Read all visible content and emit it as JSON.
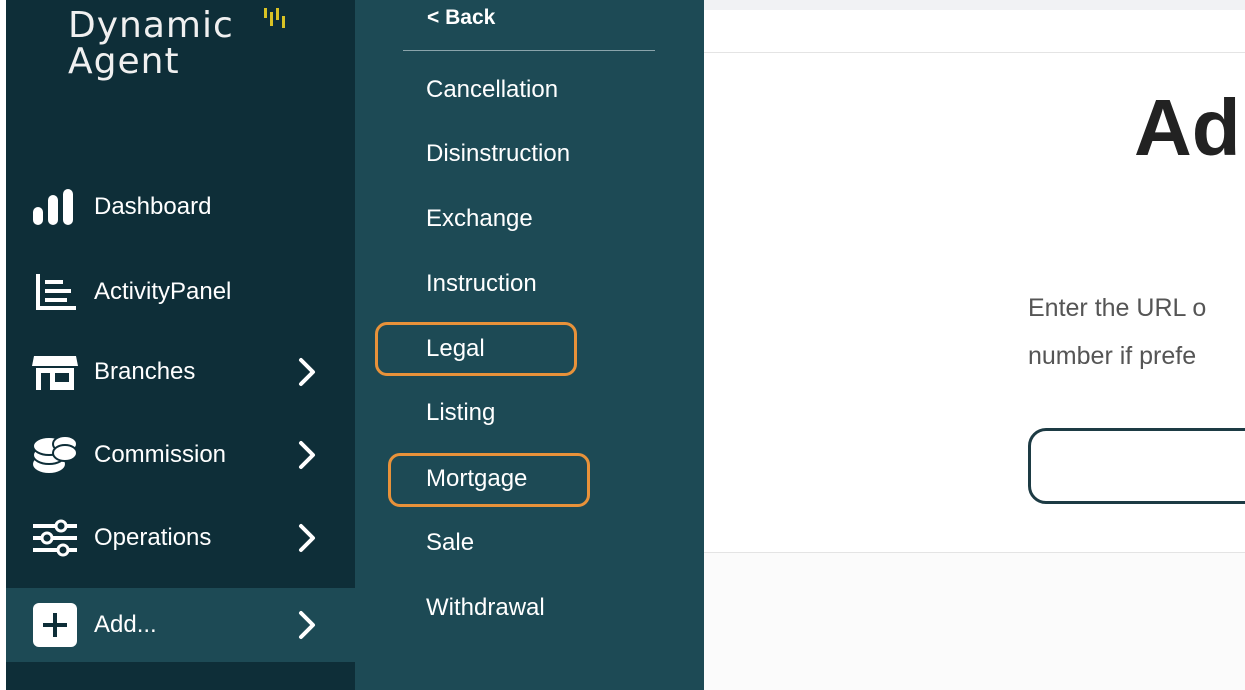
{
  "logo": {
    "line1": "Dynamic",
    "line2": "Agent"
  },
  "sidebar": {
    "items": [
      {
        "label": "Dashboard",
        "icon": "bar-chart-icon",
        "has_arrow": false
      },
      {
        "label": "ActivityPanel",
        "icon": "activity-list-icon",
        "has_arrow": false
      },
      {
        "label": "Branches",
        "icon": "storefront-icon",
        "has_arrow": true
      },
      {
        "label": "Commission",
        "icon": "coins-icon",
        "has_arrow": true
      },
      {
        "label": "Operations",
        "icon": "sliders-icon",
        "has_arrow": true
      },
      {
        "label": "Add...",
        "icon": "plus-icon",
        "has_arrow": true
      }
    ]
  },
  "submenu": {
    "back_label": "< Back",
    "items": [
      "Cancellation",
      "Disinstruction",
      "Exchange",
      "Instruction",
      "Legal",
      "Listing",
      "Mortgage",
      "Sale",
      "Withdrawal"
    ],
    "highlighted": [
      "Legal",
      "Mortgage"
    ]
  },
  "main": {
    "heading": "Ad",
    "description_line1": "Enter the URL o",
    "description_line2": "number if prefe",
    "url_input_value": ""
  },
  "colors": {
    "sidebar_bg": "#0e2e38",
    "submenu_bg": "#1d4a55",
    "highlight": "#e8923a",
    "logo_accent": "#d9c325"
  }
}
